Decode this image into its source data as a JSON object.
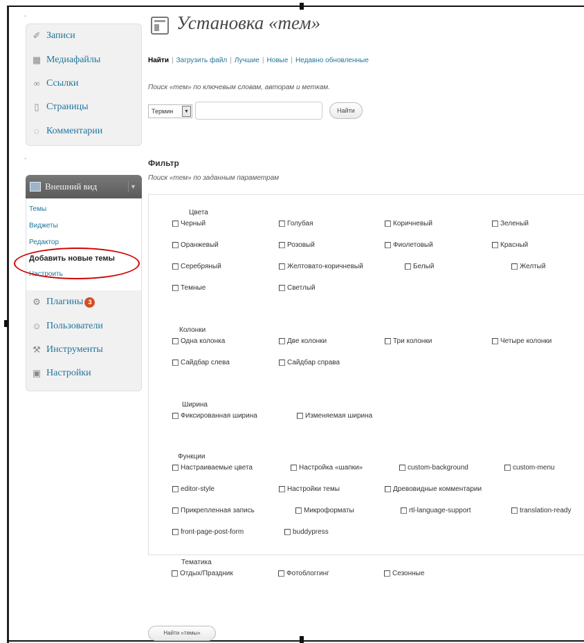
{
  "sidebar": {
    "group1": [
      {
        "label": "Записи",
        "icon": "pin-icon"
      },
      {
        "label": "Медиафайлы",
        "icon": "media-icon"
      },
      {
        "label": "Ссылки",
        "icon": "link-icon"
      },
      {
        "label": "Страницы",
        "icon": "page-icon"
      },
      {
        "label": "Комментарии",
        "icon": "comment-icon"
      }
    ],
    "appearance": {
      "label": "Внешний вид",
      "items": [
        "Темы",
        "Виджеты",
        "Редактор",
        "Добавить новые темы",
        "Настроить"
      ]
    },
    "group3": [
      {
        "label": "Плагины",
        "icon": "plugin-icon"
      },
      {
        "label": "Пользователи",
        "icon": "users-icon"
      },
      {
        "label": "Инструменты",
        "icon": "tools-icon"
      },
      {
        "label": "Настройки",
        "icon": "settings-icon"
      }
    ],
    "plugins_badge": "3"
  },
  "main": {
    "title": "Установка «тем»",
    "tabs": [
      "Найти",
      "Загрузить файл",
      "Лучшие",
      "Новые",
      "Недавно обновленные"
    ],
    "search_desc": "Поиск «тем» по ключевым словам, авторам и меткам.",
    "search_select": "Термин",
    "search_value": "",
    "search_button": "Найти",
    "filter_heading": "Фильтр",
    "filter_desc": "Поиск «тем» по заданным параметрам",
    "filter_groups": [
      {
        "title": "Цвета",
        "options": [
          "Черный",
          "Голубая",
          "Коричневый",
          "Зеленый",
          "Оранжевый",
          "Розовый",
          "Фиолетовый",
          "Красный",
          "Серебряный",
          "Желтовато-коричневый",
          "Белый",
          "Желтый",
          "Темные",
          "Светлый"
        ]
      },
      {
        "title": "Колонки",
        "options": [
          "Одна колонка",
          "Две колонки",
          "Три колонки",
          "Четыре колонки",
          "Сайдбар слева",
          "Сайдбар справа"
        ]
      },
      {
        "title": "Ширина",
        "options": [
          "Фиксированная ширина",
          "Изменяемая ширина"
        ]
      },
      {
        "title": "Функции",
        "options": [
          "Настраиваемые цвета",
          "Настройка «шапки»",
          "custom-background",
          "custom-menu",
          "editor-style",
          "Настройки темы",
          "Древовидные комментарии",
          "Прикрепленная запись",
          "Микроформаты",
          "rtl-language-support",
          "translation-ready",
          "front-page-post-form",
          "buddypress"
        ]
      },
      {
        "title": "Тематика",
        "options": [
          "Отдых/Праздник",
          "Фотоблоггинг",
          "Сезонные"
        ]
      }
    ],
    "apply_button": "Найти «темы»"
  },
  "colors": {
    "link": "#21759b",
    "highlight": "#d00000",
    "badge": "#d54e21"
  }
}
